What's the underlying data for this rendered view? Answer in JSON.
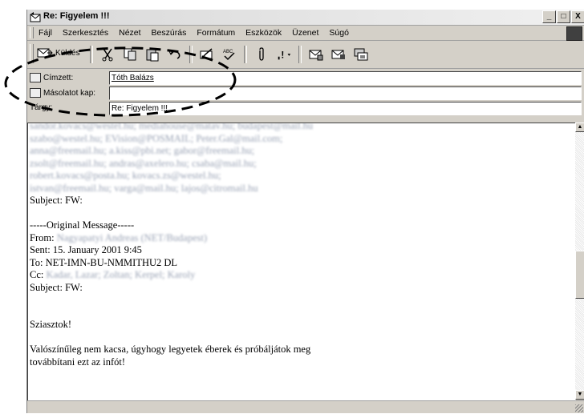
{
  "window": {
    "title": "Re: Figyelem !!!",
    "controls": [
      "_",
      "□",
      "X"
    ]
  },
  "menu": {
    "items": [
      "Fájl",
      "Szerkesztés",
      "Nézet",
      "Beszúrás",
      "Formátum",
      "Eszközök",
      "Üzenet",
      "Súgó"
    ]
  },
  "toolbar": {
    "send_label": "Küldés",
    "icons": [
      "cut-icon",
      "copy-icon",
      "paste-icon",
      "undo-icon",
      "check-names-icon",
      "spelling-icon",
      "attach-icon",
      "priority-icon",
      "sign-icon",
      "encrypt-icon",
      "offline-icon"
    ]
  },
  "header": {
    "to_label": "Címzett:",
    "to_value": "Tóth Balázs",
    "cc_label": "Másolatot kap:",
    "cc_value": "",
    "subject_label": "Tárgy:",
    "subject_value": "Re: Figyelem !!!"
  },
  "body": {
    "blurred_lines": [
      "sandor.kovacs@westel.hu; mediahouse@matav.hu; budapest@mail.hu",
      "szabo@westel.hu; EVision@POSMAIL; Peter.Gal@mail.com;",
      "anna@freemail.hu; a.kiss@pbi.net; gabor@freemail.hu;",
      "zsolt@freemail.hu; andras@axelero.hu; csaba@mail.hu;",
      "robert.kovacs@posta.hu; kovacs.zs@westel.hu;",
      "istvan@freemail.hu; varga@mail.hu; lajos@citromail.hu"
    ],
    "subject_line_1": "Subject: FW:",
    "original_message": "-----Original Message-----",
    "from_label": "From:",
    "from_value": "Nagyapatyi Andreas (NET/Budapest)",
    "sent": "Sent: 15. January 2001 9:45",
    "to": "To: NET-IMN-BU-NMMITHU2 DL",
    "cc_label": "Cc:",
    "cc_value": "Kadar, Lazar; Zoltan; Kerpel; Karoly",
    "subject_line_2": "Subject: FW:",
    "greeting": "Sziasztok!",
    "paragraph_1": "Valószínűleg nem kacsa, úgyhogy legyetek éberek és próbáljátok meg",
    "paragraph_2": "továbbítani ezt az infót!"
  }
}
